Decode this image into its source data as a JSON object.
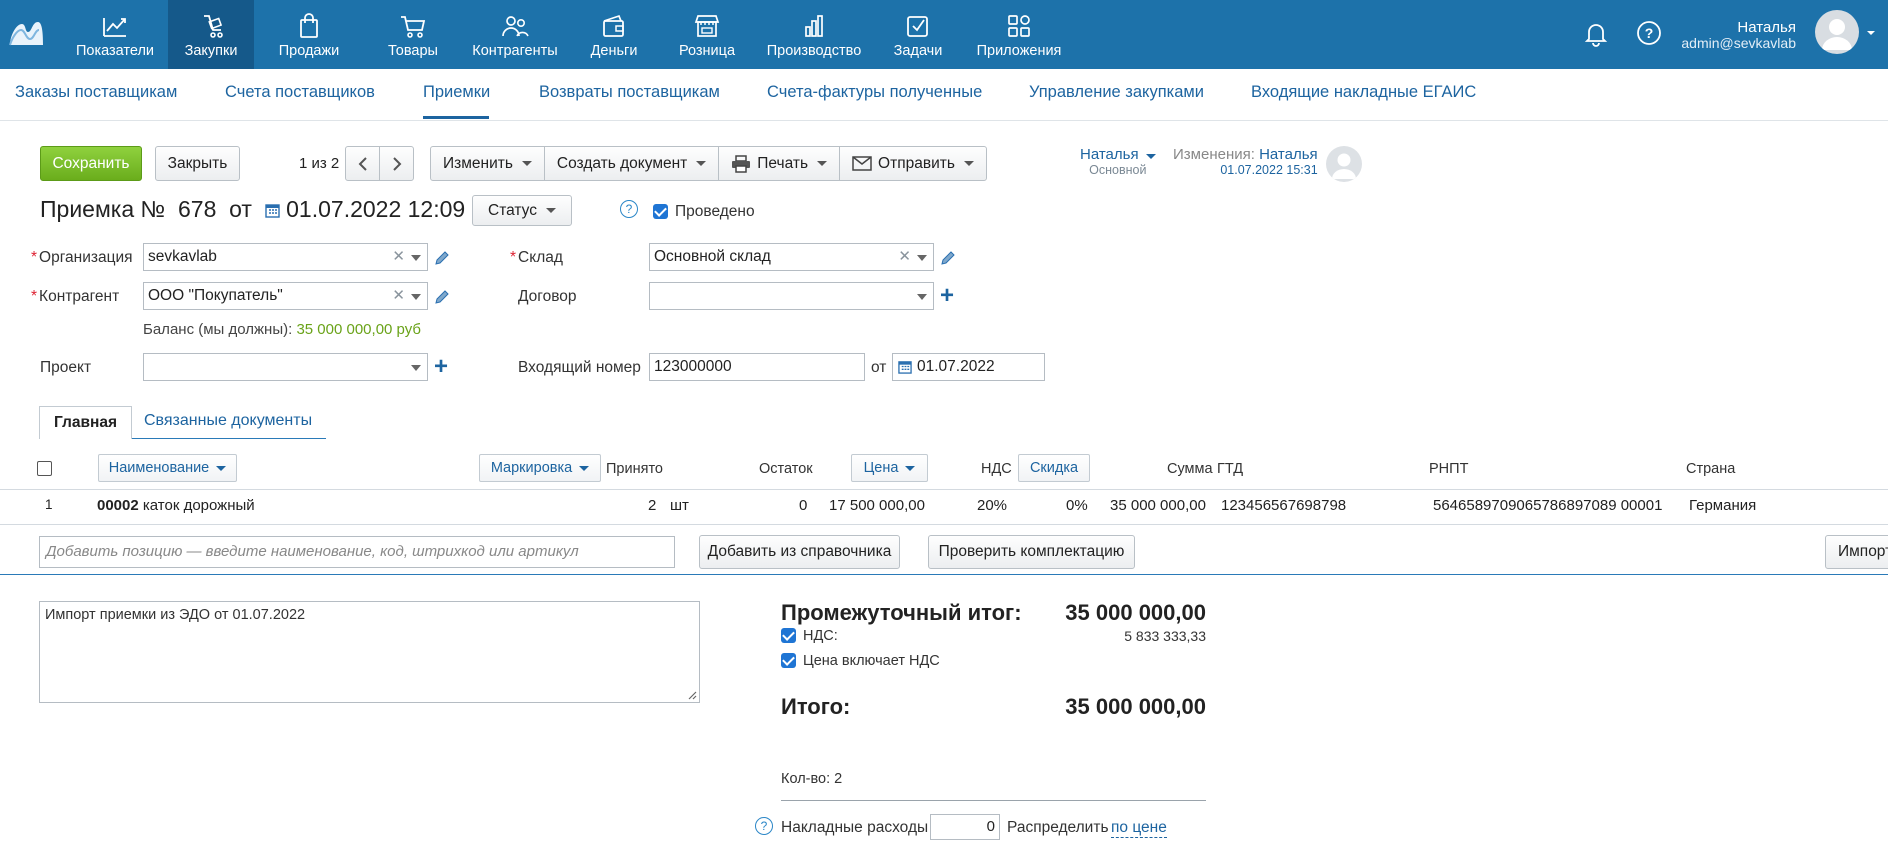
{
  "topbar": {
    "nav": [
      {
        "label": "Показатели",
        "icon": "chart-line-icon"
      },
      {
        "label": "Закупки",
        "icon": "purchases-icon",
        "active": true
      },
      {
        "label": "Продажи",
        "icon": "shopping-bag-icon"
      },
      {
        "label": "Товары",
        "icon": "cart-icon"
      },
      {
        "label": "Контрагенты",
        "icon": "people-icon"
      },
      {
        "label": "Деньги",
        "icon": "wallet-icon"
      },
      {
        "label": "Розница",
        "icon": "store-icon"
      },
      {
        "label": "Производство",
        "icon": "bar-chart-icon"
      },
      {
        "label": "Задачи",
        "icon": "checkbox-icon"
      },
      {
        "label": "Приложения",
        "icon": "apps-icon"
      }
    ],
    "user_name": "Наталья",
    "user_email": "admin@sevkavlab"
  },
  "subnav": [
    {
      "label": "Заказы поставщикам"
    },
    {
      "label": "Счета поставщиков"
    },
    {
      "label": "Приемки",
      "active": true
    },
    {
      "label": "Возвраты поставщикам"
    },
    {
      "label": "Счета-фактуры полученные"
    },
    {
      "label": "Управление закупками"
    },
    {
      "label": "Входящие накладные ЕГАИС"
    }
  ],
  "toolbar": {
    "save": "Сохранить",
    "close": "Закрыть",
    "pager": "1 из 2",
    "edit": "Изменить",
    "create_doc": "Создать документ",
    "print": "Печать",
    "send": "Отправить"
  },
  "owner": {
    "name": "Наталья",
    "group": "Основной"
  },
  "changes": {
    "label": "Изменения:",
    "who": "Наталья",
    "when": "01.07.2022 15:31"
  },
  "doc": {
    "title_prefix": "Приемка №",
    "number": "678",
    "from": "от",
    "date": "01.07.2022 12:09",
    "status": "Статус",
    "posted": "Проведено"
  },
  "form": {
    "org_label": "Организация",
    "org_value": "sevkavlab",
    "counterparty_label": "Контрагент",
    "counterparty_value": "ООО \"Покупатель\"",
    "balance_label": "Баланс (мы должны):",
    "balance_value": "35 000 000,00 руб",
    "project_label": "Проект",
    "project_value": "",
    "warehouse_label": "Склад",
    "warehouse_value": "Основной склад",
    "contract_label": "Договор",
    "contract_value": "",
    "incoming_label": "Входящий номер",
    "incoming_value": "123000000",
    "incoming_from": "от",
    "incoming_date": "01.07.2022"
  },
  "tabs": {
    "main": "Главная",
    "related": "Связанные документы"
  },
  "table": {
    "headers": {
      "name": "Наименование",
      "marking": "Маркировка",
      "accepted": "Принято",
      "remainder": "Остаток",
      "price": "Цена",
      "vat": "НДС",
      "discount": "Скидка",
      "sum": "Сумма",
      "gtd": "ГТД",
      "rnpt": "РНПТ",
      "country": "Страна"
    },
    "rows": [
      {
        "index": "1",
        "code": "00002",
        "name": "каток дорожный",
        "qty": "2",
        "unit": "шт",
        "remainder": "0",
        "price": "17 500 000,00",
        "vat": "20%",
        "discount": "0%",
        "sum": "35 000 000,00",
        "gtd": "123456567698798",
        "rnpt": "5646589709065786897089 00001",
        "country": "Германия"
      }
    ],
    "add_placeholder": "Добавить позицию — введите наименование, код, штрихкод или артикул",
    "add_from_catalog": "Добавить из справочника",
    "check_kit": "Проверить комплектацию",
    "import": "Импорт"
  },
  "comment": "Импорт приемки из ЭДО от 01.07.2022",
  "totals": {
    "subtotal_label": "Промежуточный итог:",
    "subtotal_value": "35 000 000,00",
    "vat_label": "НДС:",
    "vat_value": "5 833 333,33",
    "price_incl_vat": "Цена включает НДС",
    "total_label": "Итого:",
    "total_value": "35 000 000,00",
    "qty_label": "Кол-во: 2",
    "overhead_label": "Накладные расходы",
    "overhead_value": "0",
    "distribute_label": "Распределить",
    "distribute_link": "по цене"
  }
}
